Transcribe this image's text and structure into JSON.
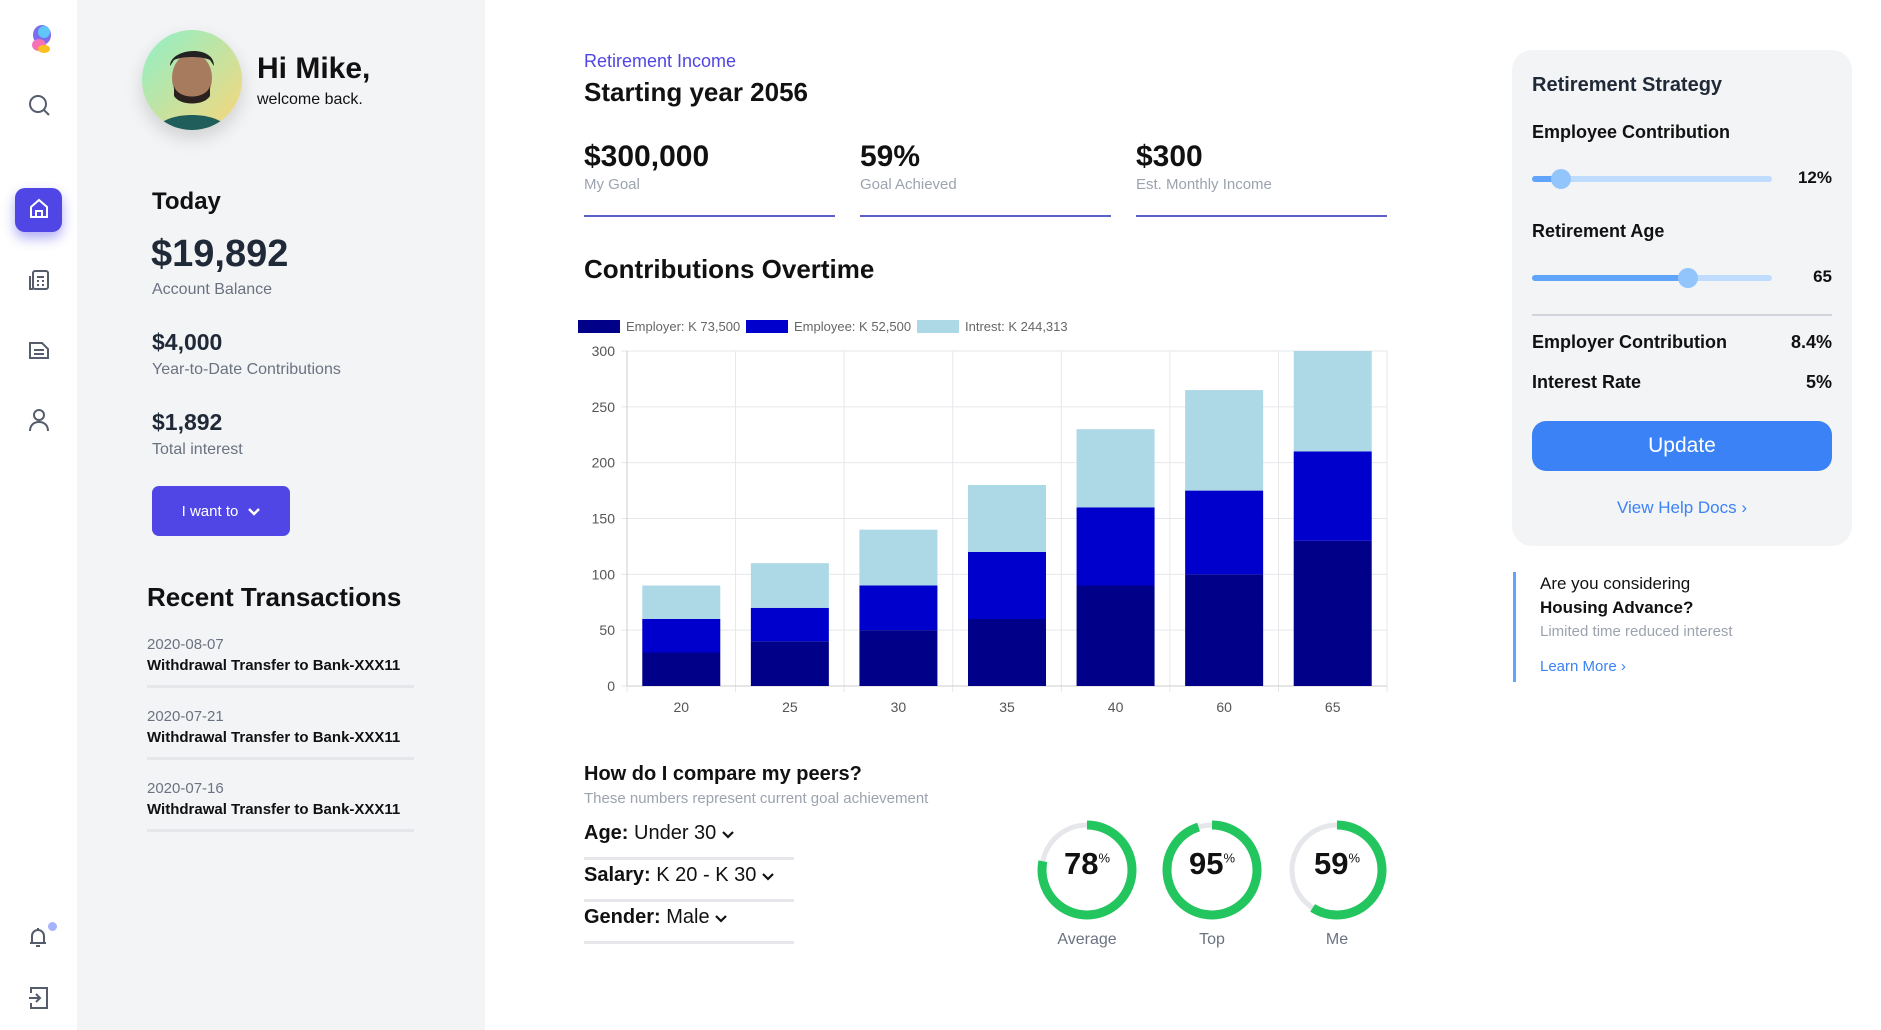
{
  "user": {
    "greeting": "Hi Mike,",
    "subtitle": "welcome back."
  },
  "nav": [
    "logo-icon",
    "search-icon",
    "home-icon",
    "calculator-icon",
    "document-icon",
    "user-icon",
    "bell-icon",
    "logout-icon"
  ],
  "today": {
    "title": "Today",
    "balance": "$19,892",
    "balance_label": "Account Balance",
    "ytd": "$4,000",
    "ytd_label": "Year-to-Date Contributions",
    "interest": "$1,892",
    "interest_label": "Total interest",
    "action_button": "I want to"
  },
  "transactions": {
    "title": "Recent Transactions",
    "items": [
      {
        "date": "2020-08-07",
        "title": "Withdrawal Transfer to Bank-XXX11"
      },
      {
        "date": "2020-07-21",
        "title": "Withdrawal Transfer to Bank-XXX11"
      },
      {
        "date": "2020-07-16",
        "title": "Withdrawal Transfer to Bank-XXX11"
      }
    ]
  },
  "main": {
    "eyebrow": "Retirement Income",
    "title": "Starting year 2056",
    "stats": [
      {
        "value": "$300,000",
        "label": "My Goal"
      },
      {
        "value": "59%",
        "label": "Goal Achieved"
      },
      {
        "value": "$300",
        "label": "Est. Monthly Income"
      }
    ],
    "chart_title": "Contributions Overtime"
  },
  "chart_data": {
    "type": "bar",
    "stacked": true,
    "categories": [
      "20",
      "25",
      "30",
      "35",
      "40",
      "60",
      "65"
    ],
    "series": [
      {
        "name": "Employer: K 73,500",
        "color": "#000088",
        "values": [
          30,
          40,
          50,
          60,
          90,
          100,
          130
        ]
      },
      {
        "name": "Employee: K 52,500",
        "color": "#0000cd",
        "values": [
          30,
          30,
          40,
          60,
          70,
          75,
          80
        ]
      },
      {
        "name": "Intrest: K 244,313",
        "color": "#add8e6",
        "values": [
          30,
          40,
          50,
          60,
          70,
          90,
          90
        ]
      }
    ],
    "ylim": [
      0,
      300
    ],
    "yticks": [
      "0",
      "50",
      "100",
      "150",
      "200",
      "250",
      "300"
    ],
    "grid": true,
    "legend": "top"
  },
  "peers": {
    "title": "How do I compare my peers?",
    "subtitle": "These numbers represent current goal achievement",
    "filters": [
      {
        "label": "Age:",
        "value": "Under 30"
      },
      {
        "label": "Salary:",
        "value": "K 20 - K 30"
      },
      {
        "label": "Gender:",
        "value": "Male"
      }
    ],
    "rings": [
      {
        "value": 78,
        "text": "78",
        "label": "Average"
      },
      {
        "value": 95,
        "text": "95",
        "label": "Top"
      },
      {
        "value": 59,
        "text": "59",
        "label": "Me"
      }
    ],
    "pct": "%",
    "color": "#22c55e"
  },
  "strategy": {
    "title": "Retirement Strategy",
    "employee_label": "Employee Contribution",
    "employee_value": "12%",
    "employee_fraction": 0.12,
    "age_label": "Retirement Age",
    "age_value": "65",
    "age_fraction": 0.65,
    "employer_label": "Employer Contribution",
    "employer_value": "8.4%",
    "rate_label": "Interest Rate",
    "rate_value": "5%",
    "update": "Update",
    "help": "View Help Docs"
  },
  "promo": {
    "line1": "Are you considering",
    "line2": "Housing Advance?",
    "line3": "Limited time reduced interest",
    "link": "Learn More"
  }
}
